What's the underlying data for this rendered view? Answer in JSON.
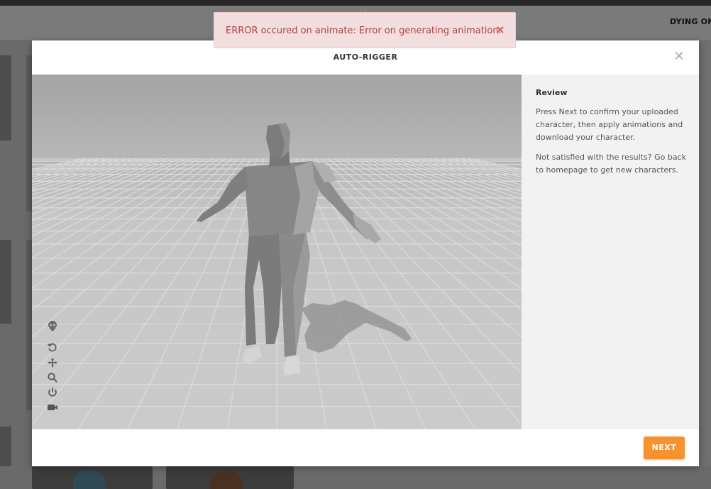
{
  "background": {
    "header_title": "DYING ON"
  },
  "modal": {
    "title": "AUTO-RIGGER",
    "close_glyph": "✕",
    "panel": {
      "heading": "Review",
      "paragraphs": [
        "Press Next to confirm your uploaded character, then apply animations and download your character.",
        "Not satisfied with the results? Go back to homepage to get new characters."
      ]
    },
    "next_label": "NEXT"
  },
  "viewport_tools": [
    {
      "icon": "skull-icon"
    },
    {
      "icon": "reset-icon"
    },
    {
      "icon": "move-icon"
    },
    {
      "icon": "zoom-icon"
    },
    {
      "icon": "power-icon"
    },
    {
      "icon": "camera-icon"
    }
  ],
  "toast": {
    "message": "ERROR occured on animate: Error on generating animation.",
    "close_glyph": "×",
    "colors": {
      "background": "#f2dede",
      "text": "#a94442"
    }
  },
  "colors": {
    "accent": "#f7932f",
    "panel_bg": "#f2f2f2"
  }
}
